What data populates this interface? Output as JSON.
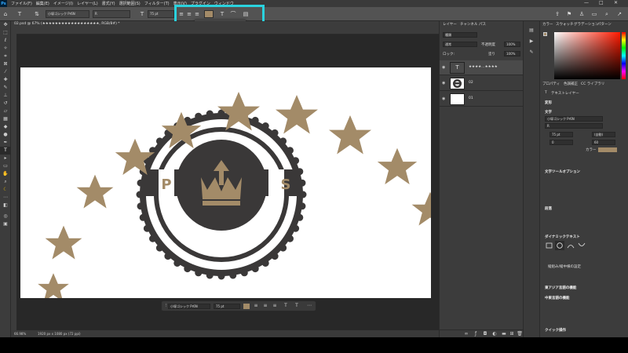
{
  "menubar": {
    "logo": "Ps",
    "items": [
      "ファイル(F)",
      "編集(E)",
      "イメージ(I)",
      "レイヤー(L)",
      "書式(Y)",
      "選択範囲(S)",
      "フィルター(T)",
      "表示(V)",
      "プラグイン",
      "ウィンドウ"
    ],
    "win_controls": [
      "—",
      "□",
      "✕"
    ]
  },
  "options": {
    "font_family": "小塚ゴシック Pr6N",
    "font_style": "R",
    "font_size": "75 pt",
    "color_swatch": "#a38b68"
  },
  "document": {
    "tab_title": "02.psd @ 67% (★★★★★★★★★★★★★★★★★★, RGB/8#) *",
    "zoom": "66.98%",
    "doc_info": "1920 px x 1080 px (72 ppi)"
  },
  "dynamic_popup": {
    "title": "ダイナミックテキスト"
  },
  "context_bar": {
    "font_family": "小塚ゴシック Pr6N",
    "font_size": "75 pt"
  },
  "artwork": {
    "left_letter": "P",
    "right_letter": "S",
    "star_color": "#a38b68",
    "dark_color": "#3a3838"
  },
  "layers_panel": {
    "tabs": [
      "レイヤー",
      "チャンネル",
      "パス"
    ],
    "filter_label": "種類",
    "blend_mode": "通常",
    "opacity_label": "不透明度",
    "opacity_value": "100%",
    "lock_label": "ロック:",
    "fill_label": "塗り",
    "fill_value": "100%",
    "layers": [
      {
        "name": "★★★★…★★★★",
        "type": "text"
      },
      {
        "name": "02",
        "type": "image"
      },
      {
        "name": "01",
        "type": "white"
      }
    ]
  },
  "color_panel": {
    "tabs": [
      "カラー",
      "スウォッチ",
      "グラデーション",
      "パターン"
    ]
  },
  "properties_panel": {
    "tabs": [
      "プロパティ",
      "色調補正",
      "CC ライブラリ"
    ],
    "layer_type": "テキストレイヤー",
    "transform_label": "変形",
    "char_label": "文字",
    "font_family": "小塚ゴシック Pr6N",
    "font_style": "R",
    "font_size": "75 pt",
    "leading": "(自動)",
    "tracking": "60",
    "kerning": "0",
    "color_label": "カラー",
    "text_options_label": "文字ツールオプション",
    "paragraph_label": "段落",
    "dynamic_label": "ダイナミックテキスト",
    "vertical_label": "縦組み/縦中横の設定",
    "more_label": "東アジア言語の機能",
    "cjk_label": "中東言語の機能",
    "quick_label": "クイック操作"
  }
}
